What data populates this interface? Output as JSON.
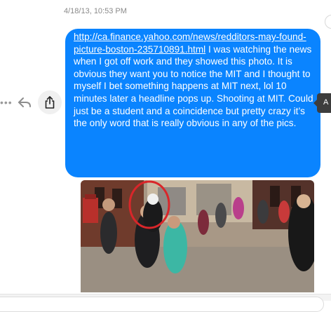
{
  "conversation": {
    "timestamp": "4/18/13, 10:53 PM",
    "message": {
      "link": "http://ca.finance.yahoo.com/news/redditors-may-found-picture-boston-235710891.html",
      "body": "  I was watching the news when I got off work and they showed this photo. It is obvious they want you to notice the MIT and I thought to myself I bet something happens at MIT next, lol 10 minutes later a headline pops up. Shooting at MIT.  Could just be a student and a coincidence but pretty crazy it’s the only word that is really obvious in any of the pics.",
      "bubble_color": "#0a84ff"
    },
    "actions": {
      "more_icon": "more-horizontal-icon",
      "reply_icon": "reply-icon",
      "share_icon": "share-icon",
      "tooltip_text": "A"
    },
    "attachment": {
      "type": "photo",
      "highlight_color": "#d9262a"
    }
  }
}
